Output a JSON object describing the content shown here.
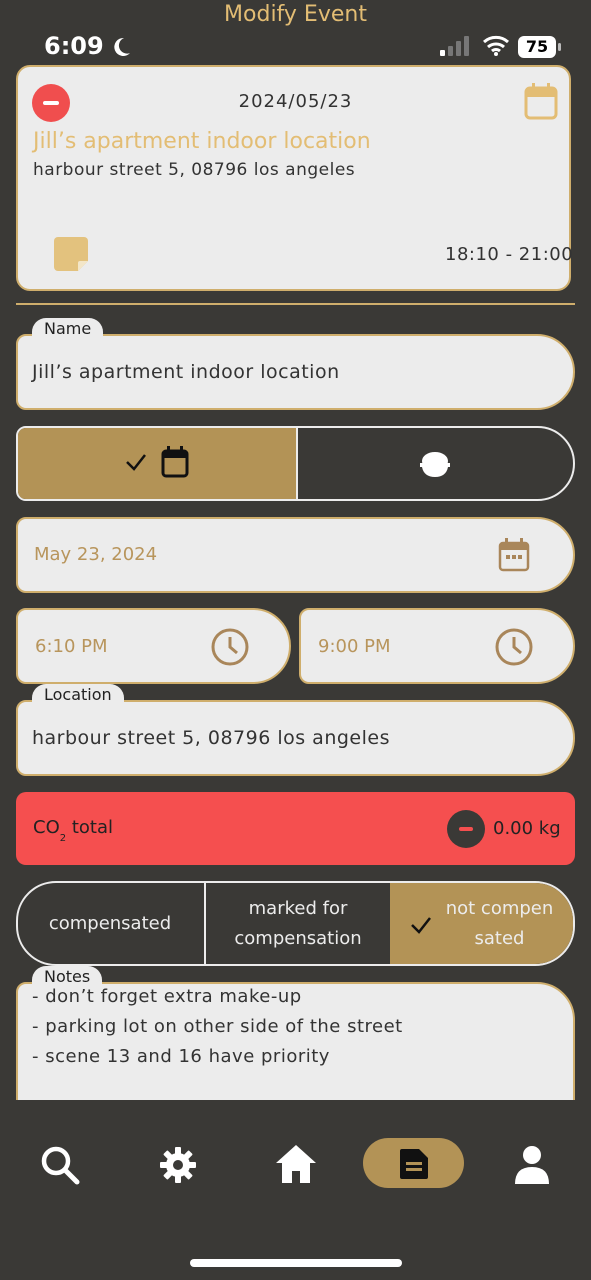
{
  "header": {
    "title": "Modify Event"
  },
  "status_bar": {
    "time": "6:09",
    "battery": "75"
  },
  "event_card": {
    "date": "2024/05/23",
    "title": "Jill’s apartment indoor location",
    "address": "harbour street 5, 08796 los angeles",
    "time_range": "18:10 - 21:00"
  },
  "form": {
    "name_label": "Name",
    "name_value": "Jill’s apartment indoor location",
    "date_value": "May 23, 2024",
    "start_time": "6:10 PM",
    "end_time": "9:00 PM",
    "location_label": "Location",
    "location_value": "harbour street 5, 08796 los angeles",
    "co2_label_main": "CO",
    "co2_label_sub": "2",
    "co2_label_tail": "total",
    "co2_value": "0.00 kg",
    "compensation": {
      "option_1": "compensated",
      "option_2_line1": "marked for",
      "option_2_line2": "compensation",
      "option_3_line1": "not compen",
      "option_3_line2": "sated"
    },
    "notes_label": "Notes",
    "notes": [
      "- don’t forget extra make-up",
      "- parking lot on other side of the street",
      "- scene 13 and 16 have priority"
    ]
  },
  "colors": {
    "background": "#3a3936",
    "accent_gold": "#cfae6c",
    "toggle_gold": "#b39356",
    "field_bg": "#ececec",
    "co2_red": "#f54f4f"
  },
  "nav": {
    "items": [
      "search-icon",
      "gear-icon",
      "home-icon",
      "document-icon",
      "user-icon"
    ],
    "active": "document-icon"
  }
}
